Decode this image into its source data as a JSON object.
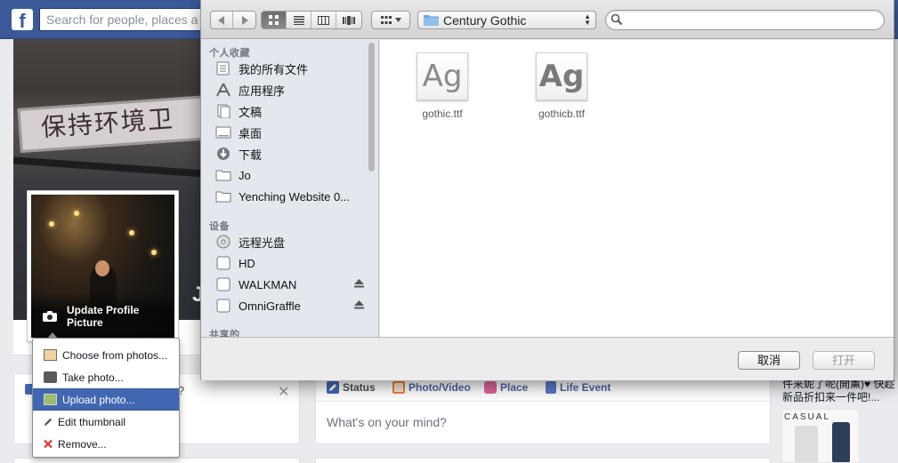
{
  "facebook": {
    "logo": "f",
    "search_placeholder": "Search for people, places a",
    "cover_sign_text": "保持环境卫",
    "name_initial": "J",
    "profile": {
      "update_label": "Update Profile Picture"
    },
    "photo_menu": [
      {
        "label": "Choose from photos...",
        "icon": "photo-album-icon",
        "active": false
      },
      {
        "label": "Take photo...",
        "icon": "camera-icon",
        "active": false
      },
      {
        "label": "Upload photo...",
        "icon": "upload-photo-icon",
        "active": true
      },
      {
        "label": "Edit thumbnail",
        "icon": "pencil-icon",
        "active": false
      },
      {
        "label": "Remove...",
        "icon": "remove-x-icon",
        "active": false
      }
    ],
    "left_card": {
      "question_mark": "?",
      "dismiss": "✕"
    },
    "composer": {
      "tabs": [
        {
          "label": "Status",
          "icon": "status-pencil-icon",
          "color": "#4267b2"
        },
        {
          "label": "Photo/Video",
          "icon": "photo-video-icon",
          "color": "#e5843a"
        },
        {
          "label": "Place",
          "icon": "place-pin-icon",
          "color": "#e0679a"
        },
        {
          "label": "Life Event",
          "icon": "life-event-flag-icon",
          "color": "#5b7ac7"
        }
      ],
      "placeholder": "What's on your mind?"
    },
    "ad": {
      "text": "件来妮了呢(開薰)♥ 快趁新品折扣来一件吧!...",
      "image_label": "CASUAL"
    }
  },
  "dialog": {
    "toolbar": {
      "view_modes": [
        "icon-view",
        "list-view",
        "column-view",
        "cover-flow-view"
      ],
      "active_view": 0,
      "path": "Century Gothic"
    },
    "sidebar": {
      "favorites_header": "个人收藏",
      "favorites": [
        {
          "label": "我的所有文件",
          "icon": "all-files-icon"
        },
        {
          "label": "应用程序",
          "icon": "applications-icon"
        },
        {
          "label": "文稿",
          "icon": "documents-icon"
        },
        {
          "label": "桌面",
          "icon": "desktop-icon"
        },
        {
          "label": "下载",
          "icon": "downloads-icon"
        },
        {
          "label": "Jo",
          "icon": "folder-icon"
        },
        {
          "label": "Yenching Website 0...",
          "icon": "folder-icon"
        }
      ],
      "devices_header": "设备",
      "devices": [
        {
          "label": "远程光盘",
          "icon": "remote-disc-icon",
          "eject": false
        },
        {
          "label": "HD",
          "icon": "hard-drive-icon",
          "eject": false
        },
        {
          "label": "WALKMAN",
          "icon": "external-drive-icon",
          "eject": true
        },
        {
          "label": "OmniGraffle",
          "icon": "external-drive-icon",
          "eject": true
        }
      ],
      "shared_header": "共享的"
    },
    "files": [
      {
        "name": "gothic.ttf",
        "preview": "Ag",
        "weight": "normal"
      },
      {
        "name": "gothicb.ttf",
        "preview": "Ag",
        "weight": "bold"
      }
    ],
    "buttons": {
      "cancel": "取消",
      "open": "打开"
    }
  }
}
